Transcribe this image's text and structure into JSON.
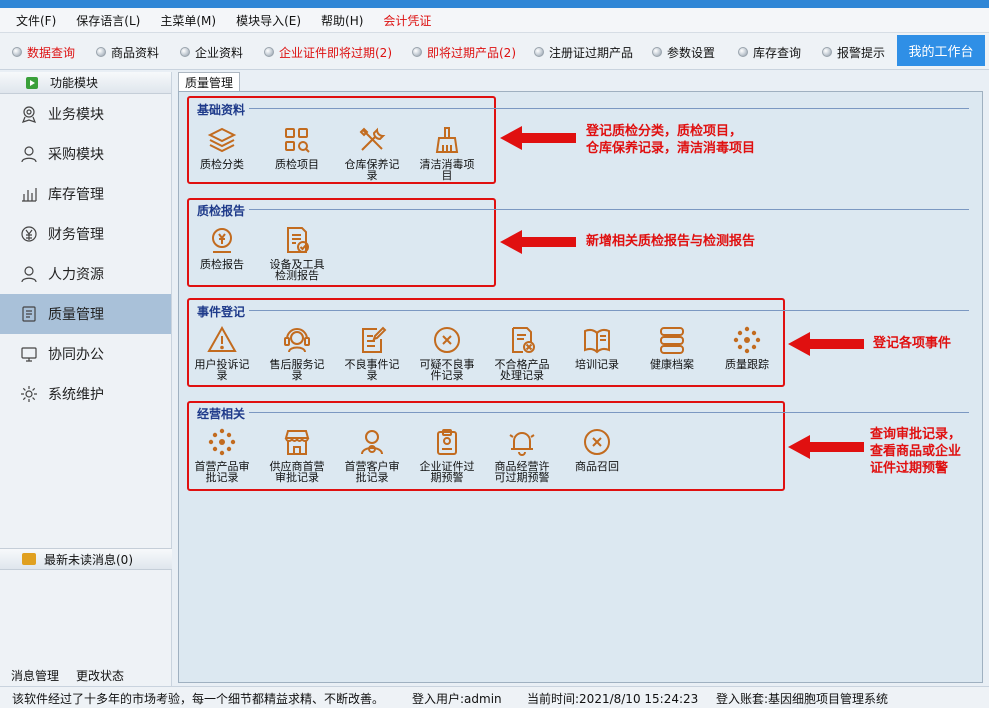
{
  "menu": [
    "文件(F)",
    "保存语言(L)",
    "主菜单(M)",
    "模块导入(E)",
    "帮助(H)",
    "会计凭证"
  ],
  "toolbar": {
    "items": [
      "数据查询",
      "商品资料",
      "企业资料",
      "企业证件即将过期(2)",
      "即将过期产品(2)",
      "注册证过期产品",
      "参数设置",
      "库存查询",
      "报警提示"
    ],
    "workbench": "我的工作台"
  },
  "sidebar": {
    "header": "功能模块",
    "items": [
      "业务模块",
      "采购模块",
      "库存管理",
      "财务管理",
      "人力资源",
      "质量管理",
      "协同办公",
      "系统维护"
    ],
    "unread": "最新未读消息(0)",
    "bottom": [
      "消息管理",
      "更改状态"
    ]
  },
  "tab": "质量管理",
  "groups": [
    {
      "title": "基础资料",
      "items": [
        "质检分类",
        "质检项目",
        "仓库保养记录",
        "清洁消毒项目"
      ]
    },
    {
      "title": "质检报告",
      "items": [
        "质检报告",
        "设备及工具检测报告"
      ]
    },
    {
      "title": "事件登记",
      "items": [
        "用户投诉记录",
        "售后服务记录",
        "不良事件记录",
        "可疑不良事件记录",
        "不合格产品处理记录",
        "培训记录",
        "健康档案",
        "质量跟踪"
      ]
    },
    {
      "title": "经营相关",
      "items": [
        "首营产品审批记录",
        "供应商首营审批记录",
        "首营客户审批记录",
        "企业证件过期预警",
        "商品经营许可过期预警",
        "商品召回"
      ]
    }
  ],
  "notes": [
    [
      "登记质检分类，质检项目，",
      "仓库保养记录，清洁消毒项目"
    ],
    [
      "新增相关质检报告与检测报告"
    ],
    [
      "登记各项事件"
    ],
    [
      "查询审批记录，",
      "查看商品或企业",
      "证件过期预警"
    ]
  ],
  "status": {
    "slogan": "该软件经过了十多年的市场考验，每一个细节都精益求精、不断改善。",
    "user": "登入用户:admin",
    "time": "当前时间:2021/8/10 15:24:23",
    "account": "登入账套:基因细胞项目管理系统"
  },
  "colors": {
    "accent": "#2f8fe6",
    "annotation": "#e01010",
    "icon": "#c26b1f",
    "group_title": "#1e3a8a"
  }
}
